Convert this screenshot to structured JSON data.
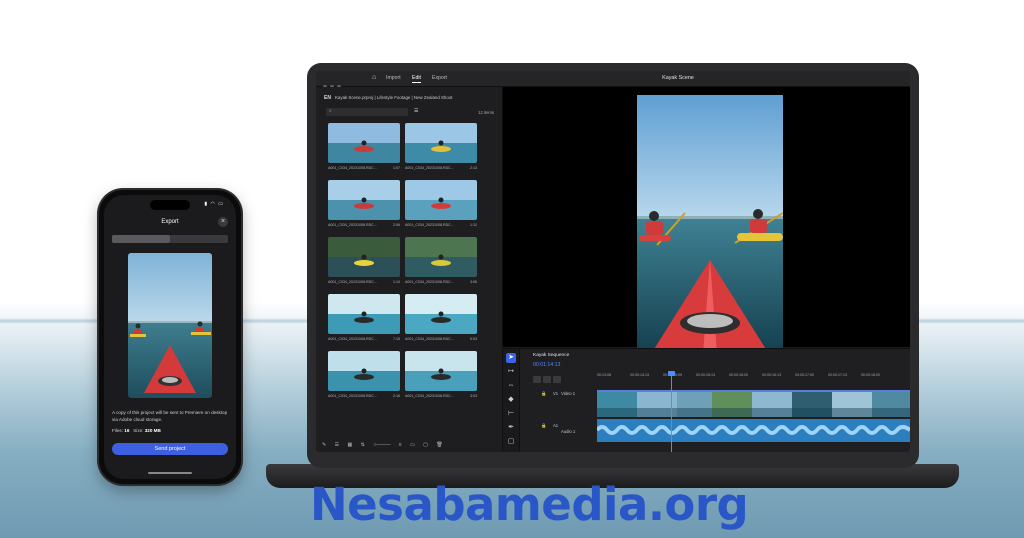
{
  "phone": {
    "status_time": "",
    "status_icons": "▮ ◠ ▭",
    "title": "Export",
    "close_icon": "×",
    "progress_fraction": 0.5,
    "note": "A copy of this project will be sent to Premiere on desktop via Adobe cloud storage.",
    "files_label": "Files:",
    "files_value": "16",
    "size_label": "Size:",
    "size_value": "320 MB",
    "send_button": "Send project"
  },
  "laptop": {
    "tabs": [
      {
        "label": "Import"
      },
      {
        "label": "Edit"
      },
      {
        "label": "Export"
      }
    ],
    "active_tab": "Edit",
    "app_title": "Kayak Scene",
    "media": {
      "bin_icon": "EN",
      "breadcrumb": "Kayak Scene.prproj | Lifestyle Footage | New Zealand Shoot",
      "items_count": "12 items",
      "thumbnails": [
        {
          "name": "A001_C034_20231008.RDC...",
          "duration": "1:07"
        },
        {
          "name": "A001_C034_20231008.RDC...",
          "duration": "2:13"
        },
        {
          "name": "A001_C034_20231008.RDC...",
          "duration": "2:06"
        },
        {
          "name": "A001_C034_20231008.RDC...",
          "duration": "1:12"
        },
        {
          "name": "A001_C034_20231008.RDC...",
          "duration": "1:10"
        },
        {
          "name": "A001_C034_20231008.RDC...",
          "duration": "3:06"
        },
        {
          "name": "A001_C034_20231008.RDC...",
          "duration": "7:15"
        },
        {
          "name": "A001_C034_20231008.RDC...",
          "duration": "0:03"
        },
        {
          "name": "A001_C034_20231008.RDC...",
          "duration": "2:16"
        },
        {
          "name": "A001_C034_20231008.RDC...",
          "duration": "3:03"
        }
      ]
    },
    "timeline": {
      "sequence_name": "Kayak Sequence",
      "timecode": "00:01:14:13",
      "ruler": [
        "00:13:08",
        "00:00:14:13",
        "00:00:15:09",
        "00:00:15:13",
        "00:00:16:00",
        "00:00:16:13",
        "00:00:17:00",
        "00:00:17:13",
        "00:00:18:00"
      ],
      "video_track": "Video 1",
      "video_track_id": "V1",
      "audio_track": "Audio 1",
      "audio_track_id": "A1"
    }
  },
  "watermark": "Nesabamedia.org",
  "colors": {
    "accent": "#3b63e6",
    "timecode": "#4e8cff",
    "watermark": "#2a57c8"
  }
}
